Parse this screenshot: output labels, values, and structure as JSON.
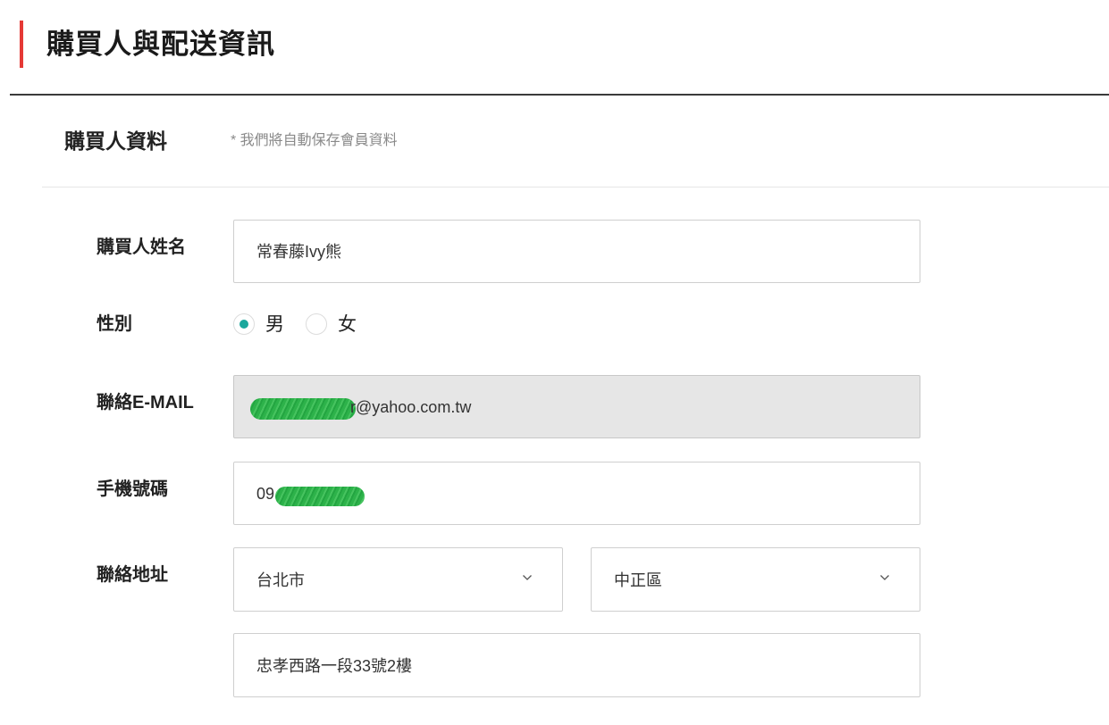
{
  "header": {
    "title": "購買人與配送資訊"
  },
  "buyer_section": {
    "title": "購買人資料",
    "note": "* 我們將自動保存會員資料"
  },
  "fields": {
    "name": {
      "label": "購買人姓名",
      "value": "常春藤Ivy熊"
    },
    "gender": {
      "label": "性別",
      "options": [
        {
          "label": "男",
          "selected": true
        },
        {
          "label": "女",
          "selected": false
        }
      ]
    },
    "email": {
      "label": "聯絡E-MAIL",
      "visible_value": "r@yahoo.com.tw"
    },
    "phone": {
      "label": "手機號碼",
      "visible_value": "09"
    },
    "address": {
      "label": "聯絡地址",
      "city": "台北市",
      "district": "中正區",
      "street": "忠孝西路一段33號2樓"
    }
  },
  "colors": {
    "accent_bar": "#e53935",
    "radio_selected": "#1aa79c",
    "redaction_scribble": "#2db24a",
    "readonly_background": "#e6e6e6"
  },
  "icons": {
    "select_arrow": "chevron-down-icon",
    "redaction": "redaction-scribble"
  }
}
